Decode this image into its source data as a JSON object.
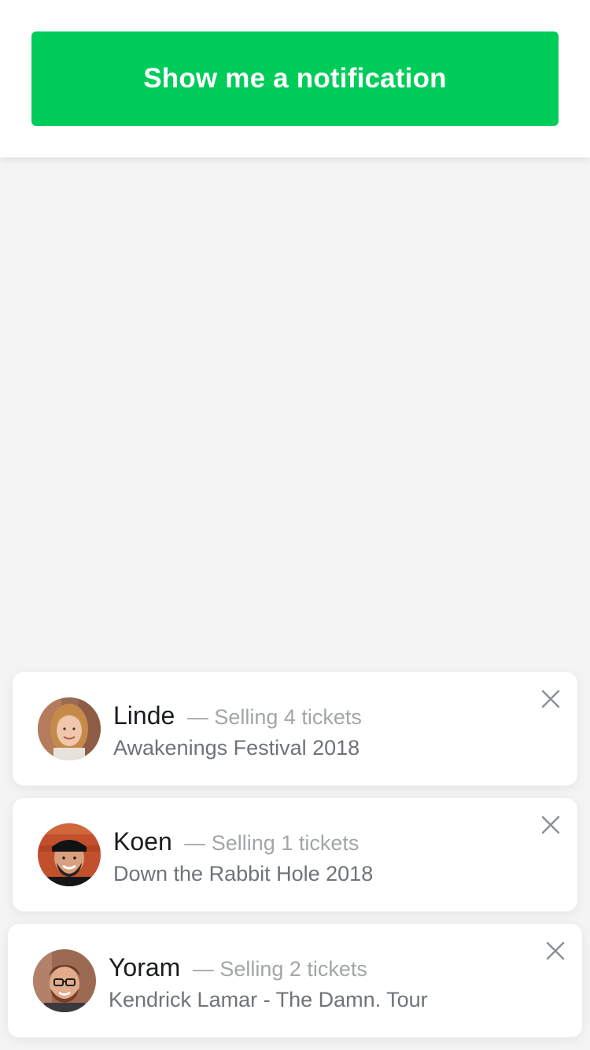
{
  "header": {
    "button_label": "Show me a notification"
  },
  "notifications": [
    {
      "name": "Linde",
      "dash": "—",
      "action": "Selling 4 tickets",
      "event": "Awakenings Festival 2018",
      "avatar_icon": "avatar-woman-blonde",
      "close_icon": "close-icon"
    },
    {
      "name": "Koen",
      "dash": "—",
      "action": "Selling 1 tickets",
      "event": "Down the Rabbit Hole 2018",
      "avatar_icon": "avatar-man-cap-beard",
      "close_icon": "close-icon"
    },
    {
      "name": "Yoram",
      "dash": "—",
      "action": "Selling 2 tickets",
      "event": "Kendrick Lamar - The Damn. Tour",
      "avatar_icon": "avatar-man-glasses-beard",
      "close_icon": "close-icon"
    }
  ],
  "colors": {
    "accent": "#00cc5a",
    "background": "#f4f4f5",
    "card": "#ffffff",
    "name_text": "#1a1d1f",
    "muted_text": "#a2a6a8",
    "event_text": "#6e7377"
  }
}
